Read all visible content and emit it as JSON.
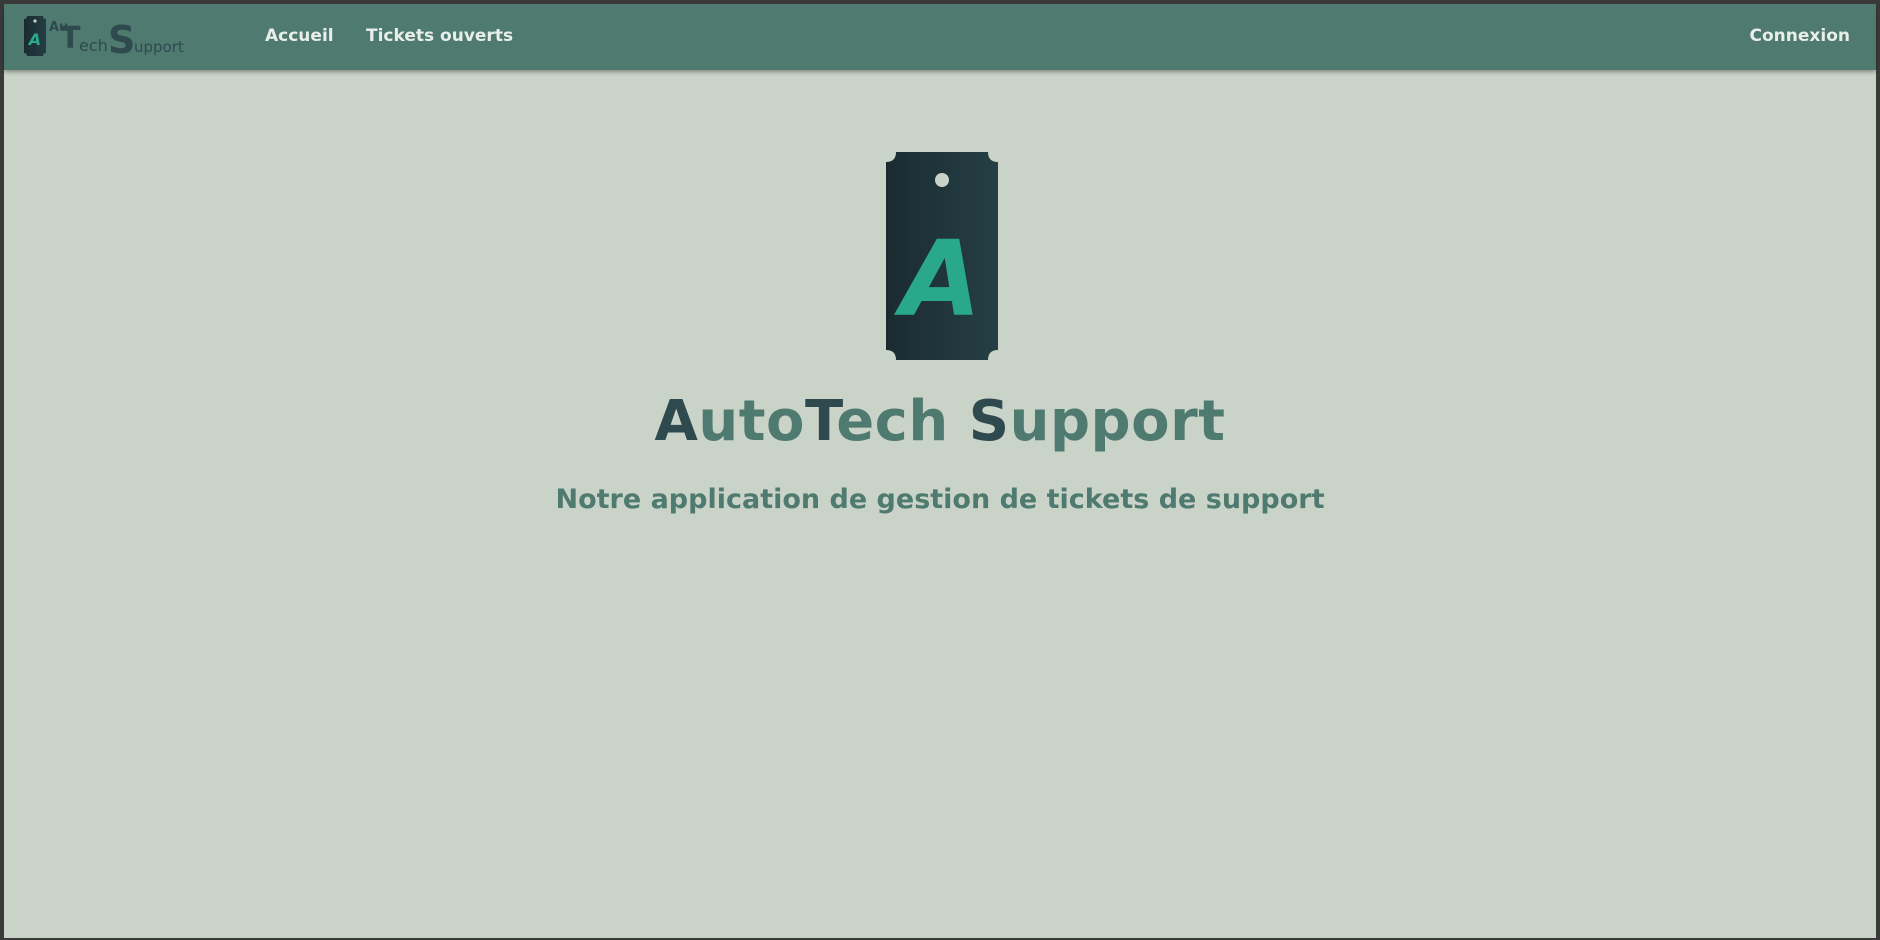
{
  "brand": {
    "parts": [
      "Au",
      "T",
      "ech",
      "S",
      "upport"
    ],
    "logo_letter": "A"
  },
  "nav": {
    "links": [
      {
        "label": "Accueil"
      },
      {
        "label": "Tickets ouverts"
      }
    ],
    "login_label": "Connexion"
  },
  "hero": {
    "logo_letter": "A",
    "title_parts": [
      "A",
      "uto",
      "T",
      "ech ",
      "S",
      "upport"
    ],
    "subtitle": "Notre application de gestion de tickets de support"
  },
  "colors": {
    "navbar": "#4f7a70",
    "background": "#cad3c8",
    "dark_text": "#2f4a4f",
    "accent_green": "#2aa88a",
    "tag_dark": "#1f3338"
  },
  "icons": {
    "brand_logo": "ticket-tag-icon",
    "hero_logo": "ticket-tag-icon"
  }
}
